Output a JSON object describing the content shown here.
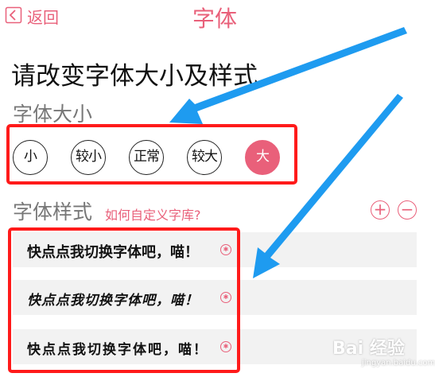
{
  "header": {
    "back_label": "返回",
    "title": "字体"
  },
  "instruction": "请改变字体大小及样式",
  "font_size": {
    "title": "字体大小",
    "options": [
      "小",
      "较小",
      "正常",
      "较大",
      "大"
    ],
    "selected": "大"
  },
  "font_style": {
    "title": "字体样式",
    "custom_link": "如何自定义字库?",
    "samples": [
      "快点点我切换字体吧，喵！",
      "快点点我切换字体吧，喵！",
      "快点点我切换字体吧，喵！"
    ]
  },
  "watermark": {
    "brand": "Bai 经验",
    "site": "jingyan.baidu.com"
  },
  "colors": {
    "accent": "#e9607a",
    "annotation_red": "#ff1a1a",
    "arrow_blue": "#1e9bf0"
  },
  "icons": {
    "back": "chevron-left-icon",
    "add": "plus-icon",
    "remove": "minus-icon",
    "select": "radio-icon"
  }
}
